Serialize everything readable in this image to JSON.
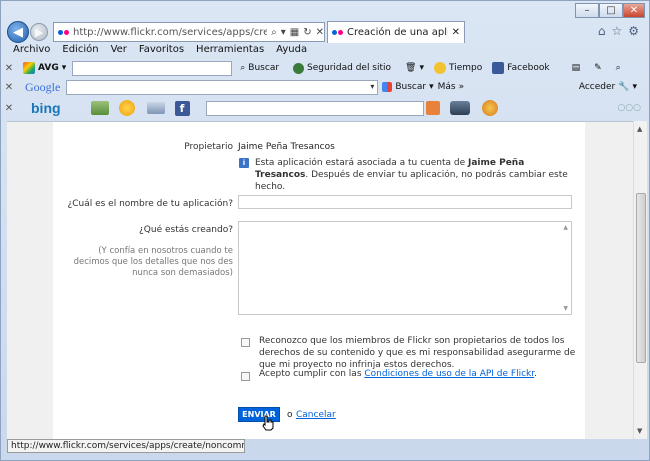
{
  "browser": {
    "url": "http://www.flickr.com/services/apps/create/noncommercial/",
    "tab_title": "Creación de una aplicación...",
    "menu": [
      "Archivo",
      "Edición",
      "Ver",
      "Favoritos",
      "Herramientas",
      "Ayuda"
    ],
    "toolbar1": {
      "brand": "AVG",
      "search_label": "Buscar",
      "security_label": "Seguridad del sitio",
      "weather_label": "Tiempo",
      "facebook_label": "Facebook"
    },
    "toolbar2": {
      "brand": "Google",
      "search_label": "Buscar",
      "more_label": "Más",
      "signin_label": "Acceder"
    },
    "toolbar3": {
      "brand": "bing"
    },
    "status_text": "http://www.flickr.com/services/apps/create/noncommercial/"
  },
  "form": {
    "owner_label": "Propietario",
    "owner_value": "Jaime Peña Tresancos",
    "notice_prefix": "Esta aplicación estará asociada a tu cuenta de ",
    "notice_name": "Jaime Peña Tresancos",
    "notice_suffix": ". Después de enviar tu aplicación, no podrás cambiar este hecho.",
    "app_name_label": "¿Cuál es el nombre de tu aplicación?",
    "app_name_value": "",
    "what_label": "¿Qué estás creando?",
    "what_hint": "(Y confía en nosotros cuando te decimos que los detalles que nos des nunca son demasiados)",
    "what_value": "",
    "check1_text": "Reconozco que los miembros de Flickr son propietarios de todos los derechos de su contenido y que es mi responsabilidad asegurarme de que mi proyecto no infrinja estos derechos.",
    "check2_prefix": "Acepto cumplir con las ",
    "check2_link": "Condiciones de uso de la API de Flickr",
    "check2_suffix": ".",
    "submit_label": "ENVIAR",
    "or_label": "o",
    "cancel_label": "Cancelar"
  },
  "colors": {
    "flickr_blue": "#0063dc",
    "flickr_pink": "#ff0084"
  }
}
